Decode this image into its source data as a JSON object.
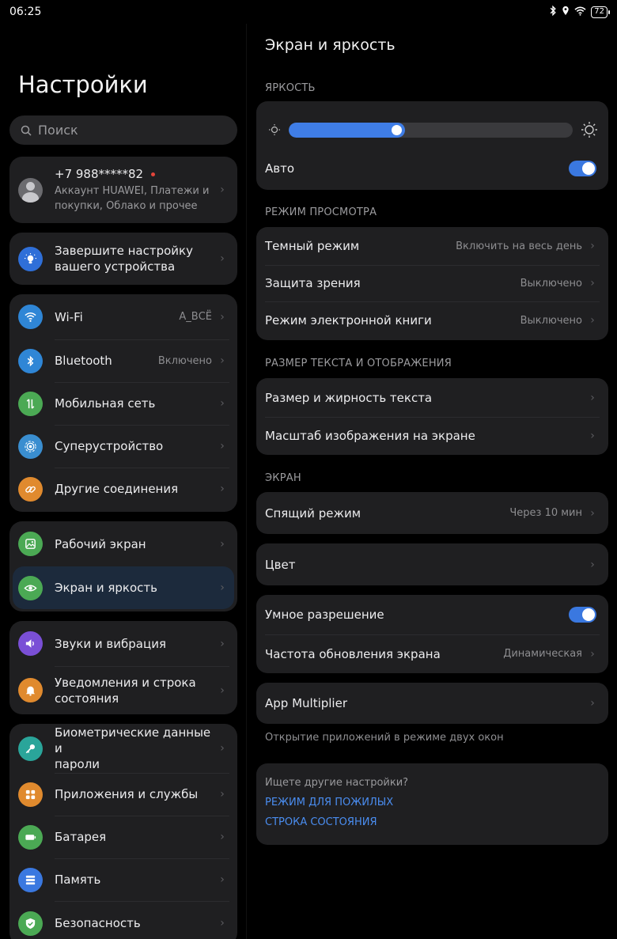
{
  "status": {
    "time": "06:25",
    "battery": "72"
  },
  "left": {
    "title": "Настройки",
    "search_placeholder": "Поиск",
    "profile": {
      "name": "+7 988*****82",
      "subtitle_line1": "Аккаунт HUAWEI, Платежи и",
      "subtitle_line2": "покупки, Облако и прочее"
    },
    "setup": {
      "line1": "Завершите настройку",
      "line2": "вашего устройства"
    },
    "connect": [
      {
        "label": "Wi-Fi",
        "value": "A_ВСЁ"
      },
      {
        "label": "Bluetooth",
        "value": "Включено"
      },
      {
        "label": "Мобильная сеть"
      },
      {
        "label": "Суперустройство"
      },
      {
        "label": "Другие соединения"
      }
    ],
    "display": [
      {
        "label": "Рабочий экран"
      },
      {
        "label": "Экран и яркость"
      }
    ],
    "sound": [
      {
        "label": "Звуки и вибрация"
      },
      {
        "line1": "Уведомления и строка",
        "line2": "состояния"
      }
    ],
    "security": [
      {
        "line1": "Биометрические данные и",
        "line2": "пароли"
      },
      {
        "label": "Приложения и службы"
      },
      {
        "label": "Батарея"
      },
      {
        "label": "Память"
      },
      {
        "label": "Безопасность"
      }
    ]
  },
  "right": {
    "title": "Экран и яркость",
    "brightness_label": "ЯРКОСТЬ",
    "brightness_level": 0.41,
    "auto_label": "Авто",
    "auto_on": true,
    "view_label": "РЕЖИМ ПРОСМОТРА",
    "view": [
      {
        "label": "Темный режим",
        "value": "Включить на весь день"
      },
      {
        "label": "Защита зрения",
        "value": "Выключено"
      },
      {
        "label": "Режим электронной книги",
        "value": "Выключено"
      }
    ],
    "text_label": "РАЗМЕР ТЕКСТА И ОТОБРАЖЕНИЯ",
    "text": [
      {
        "label": "Размер и жирность текста"
      },
      {
        "label": "Масштаб изображения на экране"
      }
    ],
    "screen_label": "ЭКРАН",
    "sleep": {
      "label": "Спящий режим",
      "value": "Через 10 мин"
    },
    "color": {
      "label": "Цвет"
    },
    "smart_res": {
      "label": "Умное разрешение",
      "on": true
    },
    "refresh": {
      "label": "Частота обновления экрана",
      "value": "Динамическая"
    },
    "app_multiplier": {
      "label": "App Multiplier",
      "hint": "Открытие приложений в режиме двух окон"
    },
    "more": {
      "title": "Ищете другие настройки?",
      "link1": "РЕЖИМ ДЛЯ ПОЖИЛЫХ",
      "link2": "СТРОКА СОСТОЯНИЯ"
    }
  },
  "colors": {
    "accent": "#3f7de6",
    "wifi": "#2f86d6",
    "bluetooth": "#2f86d6",
    "mobile": "#4ba954",
    "super": "#3a8ed0",
    "other": "#e08a2e",
    "home": "#4ba954",
    "display": "#4ba954",
    "sound": "#7a4fd6",
    "notify": "#e08a2e",
    "bio": "#2aa59a",
    "apps": "#e08a2e",
    "battery": "#4ba954",
    "storage": "#3a78e0",
    "security": "#4ba954"
  }
}
